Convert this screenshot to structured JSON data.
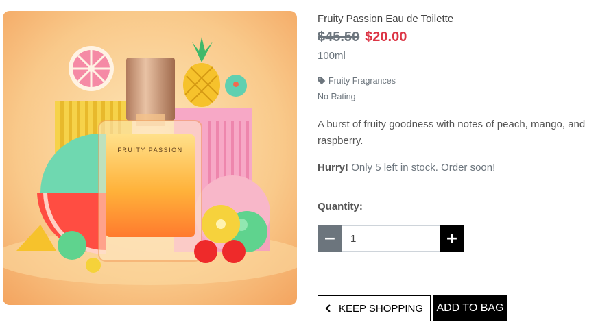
{
  "product": {
    "image_alt": "Fruity Passion perfume bottle surrounded by colorful fruit shapes",
    "bottle_label": "FRUITY PASSION",
    "name": "Fruity Passion Eau de Toilette",
    "old_price": "$45.50",
    "price": "$20.00",
    "size": "100ml",
    "category": "Fruity Fragrances",
    "category_icon": "tag-icon",
    "rating": "No Rating",
    "description": "A burst of fruity goodness with notes of peach, mango, and raspberry.",
    "stock_hurry": "Hurry!",
    "stock_message": "Only 5 left in stock. Order soon!"
  },
  "quantity": {
    "label": "Quantity:",
    "value": "1",
    "minus_label": "−",
    "plus_label": "+"
  },
  "actions": {
    "keep_shopping": "KEEP SHOPPING",
    "add_to_bag": "ADD TO BAG"
  },
  "colors": {
    "sale_price": "#dc3545",
    "muted": "#6c757d",
    "primary_button": "#000000"
  }
}
